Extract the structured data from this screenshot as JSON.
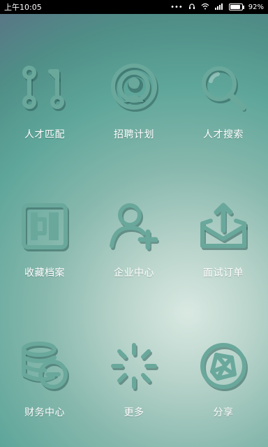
{
  "status_bar": {
    "time": "上午10:05",
    "battery_percent": "92%"
  },
  "tiles": [
    {
      "label": "人才匹配",
      "icon": "route-match-icon"
    },
    {
      "label": "招聘计划",
      "icon": "broadcast-person-icon"
    },
    {
      "label": "人才搜索",
      "icon": "search-icon"
    },
    {
      "label": "收藏档案",
      "icon": "archive-box-icon"
    },
    {
      "label": "企业中心",
      "icon": "user-add-icon"
    },
    {
      "label": "面试订单",
      "icon": "mail-upload-icon"
    },
    {
      "label": "财务中心",
      "icon": "coins-stack-icon"
    },
    {
      "label": "更多",
      "icon": "loading-spinner-icon"
    },
    {
      "label": "分享",
      "icon": "share-aperture-icon"
    }
  ],
  "colors": {
    "icon_emboss": "#6aa89c",
    "label_text": "#ffffff",
    "status_bar_bg": "#000000"
  }
}
